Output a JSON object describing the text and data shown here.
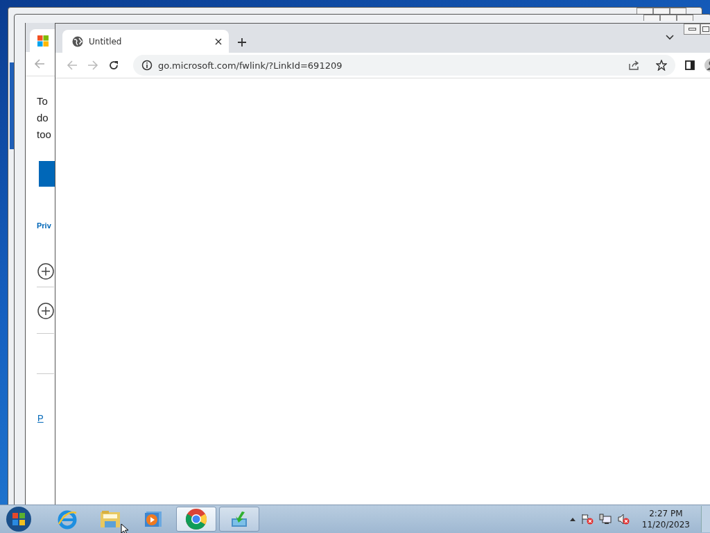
{
  "background_page": {
    "lines": [
      "To",
      "do",
      "too"
    ],
    "link": "Priv",
    "link_2": "P"
  },
  "browser": {
    "tabs": [
      {
        "title": "Untitled",
        "selected": true
      }
    ],
    "url": "go.microsoft.com/fwlink/?LinkId=691209"
  },
  "taskbar": {
    "apps": [
      {
        "kind": "ie",
        "open": false,
        "selected": false
      },
      {
        "kind": "folder",
        "open": false,
        "selected": false
      },
      {
        "kind": "media",
        "open": false,
        "selected": false
      },
      {
        "kind": "chrome",
        "open": true,
        "selected": true
      },
      {
        "kind": "installer",
        "open": true,
        "selected": false
      }
    ],
    "time": "2:27 PM",
    "date": "11/20/2023"
  }
}
